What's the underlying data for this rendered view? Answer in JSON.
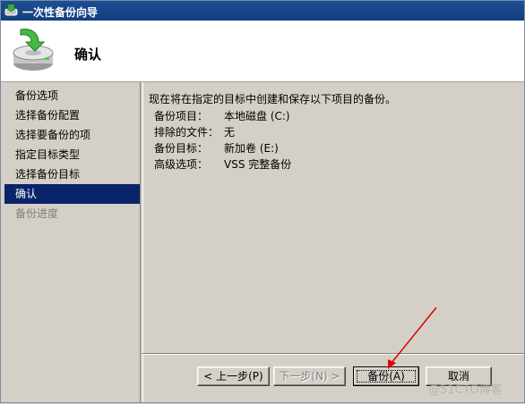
{
  "window": {
    "title": "一次性备份向导"
  },
  "header": {
    "title": "确认"
  },
  "nav": {
    "items": [
      {
        "label": "备份选项",
        "state": "normal"
      },
      {
        "label": "选择备份配置",
        "state": "normal"
      },
      {
        "label": "选择要备份的项",
        "state": "normal"
      },
      {
        "label": "指定目标类型",
        "state": "normal"
      },
      {
        "label": "选择备份目标",
        "state": "normal"
      },
      {
        "label": "确认",
        "state": "active"
      },
      {
        "label": "备份进度",
        "state": "disabled"
      }
    ]
  },
  "content": {
    "intro": "现在将在指定的目标中创建和保存以下项目的备份。",
    "rows": [
      {
        "key": "备份项目：",
        "value": "本地磁盘 (C:)"
      },
      {
        "key": "排除的文件：",
        "value": "无"
      },
      {
        "key": "备份目标：",
        "value": "新加卷 (E:)"
      },
      {
        "key": "高级选项：",
        "value": "VSS 完整备份"
      }
    ]
  },
  "buttons": {
    "back": "< 上一步(P)",
    "next": "下一步(N) >",
    "backup": "备份(A)",
    "cancel": "取消"
  },
  "watermark": "@51CTO博客",
  "colors": {
    "titlebar": "#1c4e92",
    "nav_active": "#0a246a",
    "arrow": "#e00000"
  }
}
